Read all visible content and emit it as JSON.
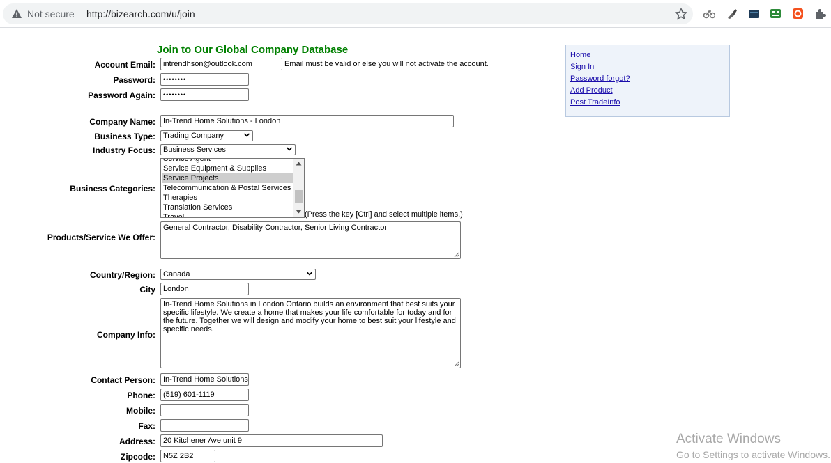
{
  "browser": {
    "security_label": "Not secure",
    "url": "http://bizearch.com/u/join"
  },
  "form": {
    "heading": "Join to Our Global Company Database",
    "account_email": {
      "label": "Account Email:",
      "value": "intrendhson@outlook.com",
      "note": "Email must be valid or else you will not activate the account."
    },
    "password": {
      "label": "Password:",
      "value": "••••••••"
    },
    "password_again": {
      "label": "Password Again:",
      "value": "••••••••"
    },
    "company_name": {
      "label": "Company Name:",
      "value": "In-Trend Home Solutions - London"
    },
    "business_type": {
      "label": "Business Type:",
      "value": "Trading Company"
    },
    "industry_focus": {
      "label": "Industry Focus:",
      "value": "Business Services"
    },
    "business_categories": {
      "label": "Business Categories:",
      "options": [
        "Service Agent",
        "Service Equipment & Supplies",
        "Service Projects",
        "Telecommunication & Postal Services",
        "Therapies",
        "Translation Services",
        "Travel"
      ],
      "selected": "Service Projects",
      "hint": "(Press the key [Ctrl] and select multiple items.)"
    },
    "products": {
      "label": "Products/Service We Offer:",
      "value": "General Contractor, Disability Contractor, Senior Living Contractor"
    },
    "country": {
      "label": "Country/Region:",
      "value": "Canada"
    },
    "city": {
      "label": "City",
      "value": "London"
    },
    "company_info": {
      "label": "Company Info:",
      "value": "In-Trend Home Solutions in London Ontario builds an environment that best suits your specific lifestyle. We create a home that makes your life comfortable for today and for the future. Together we will design and modify your home to best suit your lifestyle and specific needs."
    },
    "contact_person": {
      "label": "Contact Person:",
      "value": "In-Trend Home Solutions"
    },
    "phone": {
      "label": "Phone:",
      "value": "(519) 601-1119"
    },
    "mobile": {
      "label": "Mobile:",
      "value": ""
    },
    "fax": {
      "label": "Fax:",
      "value": ""
    },
    "address": {
      "label": "Address:",
      "value": "20 Kitchener Ave unit 9"
    },
    "zipcode": {
      "label": "Zipcode:",
      "value": "N5Z 2B2"
    }
  },
  "sidebar": {
    "links": [
      "Home",
      "Sign In",
      "Password forgot?",
      "Add Product",
      "Post TradeInfo"
    ]
  },
  "watermark": {
    "title": "Activate Windows",
    "subtitle": "Go to Settings to activate Windows."
  },
  "colors": {
    "heading": "#008000",
    "link": "#1a0dab",
    "sidebar_bg": "#eef3fa"
  }
}
